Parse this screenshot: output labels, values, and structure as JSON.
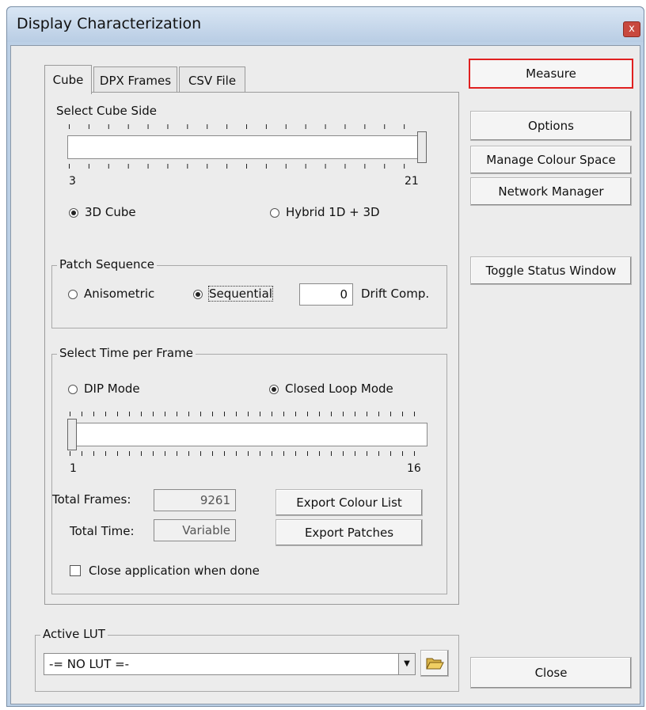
{
  "window": {
    "title": "Display Characterization",
    "close_glyph": "x"
  },
  "tabs": [
    {
      "label": "Cube",
      "active": true
    },
    {
      "label": "DPX Frames",
      "active": false
    },
    {
      "label": "CSV File",
      "active": false
    }
  ],
  "cube": {
    "select_cube_side_label": "Select Cube Side",
    "slider_min": "3",
    "slider_max": "21",
    "slider_value": 21,
    "radio_3d": "3D Cube",
    "radio_hybrid": "Hybrid 1D + 3D",
    "selected_mode": "3D Cube"
  },
  "patch_sequence": {
    "title": "Patch Sequence",
    "anisometric": "Anisometric",
    "sequential": "Sequential",
    "selected": "Sequential",
    "drift_value": "0",
    "drift_label": "Drift Comp."
  },
  "time_per_frame": {
    "title": "Select Time per Frame",
    "dip_mode": "DIP Mode",
    "closed_loop_mode": "Closed Loop Mode",
    "selected": "Closed Loop Mode",
    "slider_min": "1",
    "slider_max": "16",
    "slider_value": 1,
    "total_frames_label": "Total Frames:",
    "total_frames_value": "9261",
    "total_time_label": "Total Time:",
    "total_time_value": "Variable",
    "export_colour_list": "Export Colour List",
    "export_patches": "Export Patches",
    "close_when_done": "Close application when done",
    "close_when_done_checked": false
  },
  "active_lut": {
    "title": "Active LUT",
    "selected": "-= NO LUT =-"
  },
  "side_buttons": {
    "measure": "Measure",
    "options": "Options",
    "manage_colour_space": "Manage Colour Space",
    "network_manager": "Network Manager",
    "toggle_status_window": "Toggle Status Window",
    "close": "Close"
  },
  "colors": {
    "accent_border": "#e02020",
    "titlebar": "#c8d9ec",
    "window_bg": "#ececec"
  }
}
